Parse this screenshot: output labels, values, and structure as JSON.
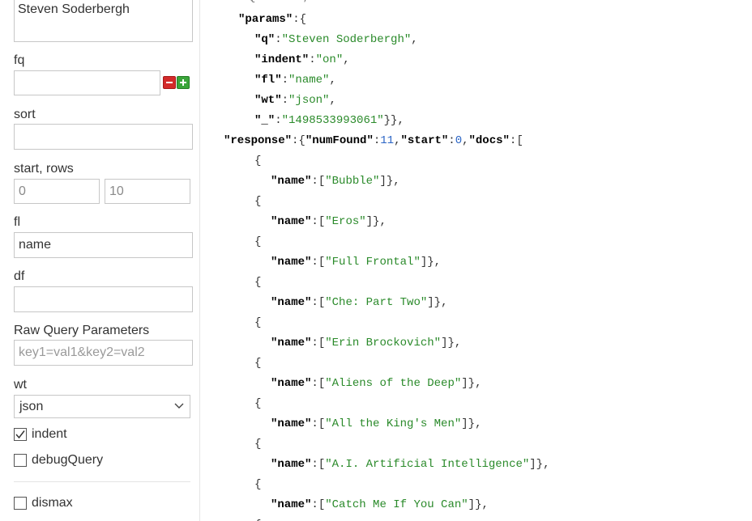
{
  "form": {
    "q": {
      "value": "Steven Soderbergh"
    },
    "fq": {
      "label": "fq",
      "value": ""
    },
    "sort": {
      "label": "sort",
      "value": ""
    },
    "start_rows": {
      "label": "start, rows",
      "start": "0",
      "rows": "10"
    },
    "fl": {
      "label": "fl",
      "value": "name"
    },
    "df": {
      "label": "df",
      "value": ""
    },
    "raw": {
      "label": "Raw Query Parameters",
      "placeholder": "key1=val1&key2=val2"
    },
    "wt": {
      "label": "wt",
      "selected": "json"
    },
    "checks": {
      "indent": {
        "label": "indent",
        "checked": true
      },
      "debugQuery": {
        "label": "debugQuery",
        "checked": false
      },
      "dismax": {
        "label": "dismax",
        "checked": false
      }
    }
  },
  "response": {
    "params": {
      "key": "\"params\"",
      "q": {
        "key": "\"q\"",
        "val": "\"Steven Soderbergh\""
      },
      "indent": {
        "key": "\"indent\"",
        "val": "\"on\""
      },
      "fl": {
        "key": "\"fl\"",
        "val": "\"name\""
      },
      "wt": {
        "key": "\"wt\"",
        "val": "\"json\""
      },
      "underscore": {
        "key": "\"_\"",
        "val": "\"1498533993061\""
      }
    },
    "response_key": "\"response\"",
    "numFound_key": "\"numFound\"",
    "numFound": "11",
    "start_key": "\"start\"",
    "start": "0",
    "docs_key": "\"docs\"",
    "name_key": "\"name\"",
    "docs": [
      "\"Bubble\"",
      "\"Eros\"",
      "\"Full Frontal\"",
      "\"Che: Part Two\"",
      "\"Erin Brockovich\"",
      "\"Aliens of the Deep\"",
      "\"All the King's Men\"",
      "\"A.I. Artificial Intelligence\"",
      "\"Catch Me If You Can\""
    ]
  }
}
